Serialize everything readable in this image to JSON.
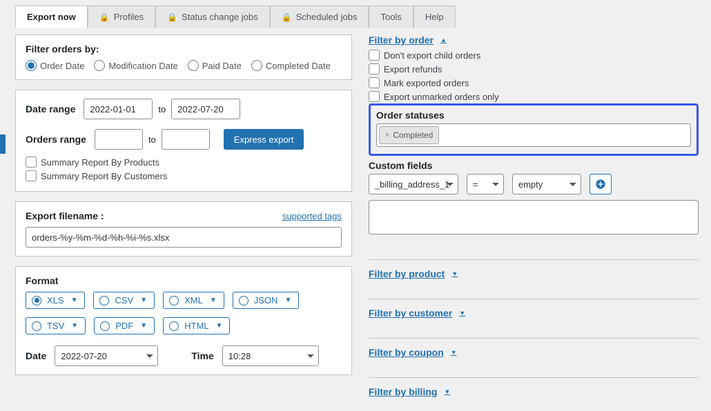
{
  "tabs": {
    "export_now": "Export now",
    "profiles": "Profiles",
    "status_jobs": "Status change jobs",
    "scheduled_jobs": "Scheduled jobs",
    "tools": "Tools",
    "help": "Help"
  },
  "filter_orders": {
    "title": "Filter orders by:",
    "order_date": "Order Date",
    "mod_date": "Modification Date",
    "paid_date": "Paid Date",
    "completed_date": "Completed Date"
  },
  "date_range": {
    "label": "Date range",
    "from": "2022-01-01",
    "to_word": "to",
    "to": "2022-07-20"
  },
  "orders_range": {
    "label": "Orders range",
    "to_word": "to",
    "express_btn": "Express export",
    "summary_products": "Summary Report By Products",
    "summary_customers": "Summary Report By Customers"
  },
  "filename": {
    "label": "Export filename :",
    "supported_tags": "supported tags",
    "value": "orders-%y-%m-%d-%h-%i-%s.xlsx"
  },
  "format": {
    "label": "Format",
    "xls": "XLS",
    "csv": "CSV",
    "xml": "XML",
    "json": "JSON",
    "tsv": "TSV",
    "pdf": "PDF",
    "html": "HTML",
    "date_lbl": "Date",
    "date_val": "2022-07-20",
    "time_lbl": "Time",
    "time_val": "10:28"
  },
  "right": {
    "filter_order": "Filter by order",
    "no_child": "Don't export child orders",
    "export_refunds": "Export refunds",
    "mark_exported": "Mark exported orders",
    "unmarked_only": "Export unmarked orders only",
    "order_statuses": "Order statuses",
    "status_chip": "Completed",
    "custom_fields": "Custom fields",
    "cf_field": "_billing_address_1",
    "cf_op": "=",
    "cf_val": "empty",
    "filter_product": "Filter by product",
    "filter_customer": "Filter by customer",
    "filter_coupon": "Filter by coupon",
    "filter_billing": "Filter by billing"
  }
}
